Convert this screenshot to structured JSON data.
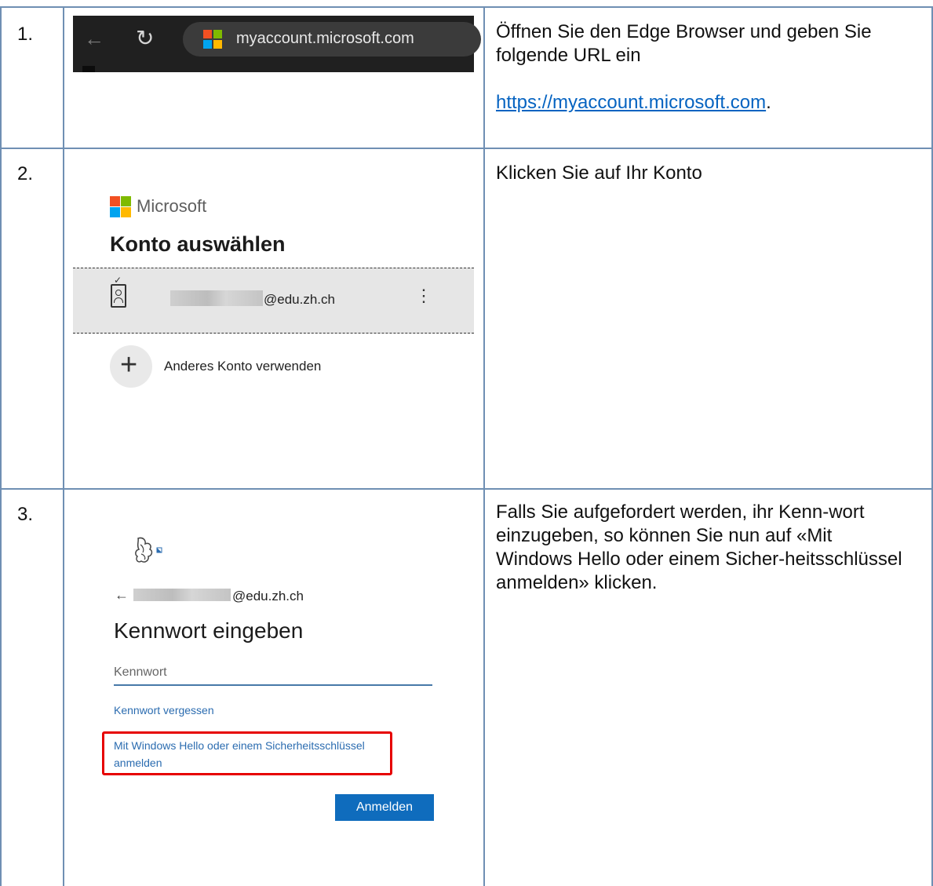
{
  "rows": [
    {
      "number": "1.",
      "browser": {
        "url": "myaccount.microsoft.com"
      },
      "description": {
        "text": "Öffnen Sie den Edge Browser und geben Sie folgende URL ein",
        "link": "https://myaccount.microsoft.com",
        "link_suffix": "."
      }
    },
    {
      "number": "2.",
      "signin": {
        "brand": "Microsoft",
        "title": "Konto auswählen",
        "account_email_suffix": "@edu.zh.ch",
        "more_icon": "⋮",
        "add_icon": "+",
        "add_account_label": "Anderes Konto verwenden"
      },
      "description": {
        "text": "Klicken Sie auf Ihr Konto"
      }
    },
    {
      "number": "3.",
      "password": {
        "back_icon": "←",
        "email_suffix": "@edu.zh.ch",
        "title": "Kennwort eingeben",
        "placeholder": "Kennwort",
        "forgot_label": "Kennwort vergessen",
        "hello_link": "Mit Windows Hello oder einem Sicherheitsschlüssel anmelden",
        "submit_label": "Anmelden"
      },
      "description": {
        "text": "Falls Sie aufgefordert werden, ihr Kenn-wort einzugeben, so können Sie nun auf «Mit Windows Hello oder einem Sicher-heitsschlüssel anmelden» klicken."
      }
    }
  ],
  "colors": {
    "border": "#6f8fb3",
    "link": "#0563c1",
    "highlight": "#e60000",
    "button": "#0f6cbd"
  }
}
